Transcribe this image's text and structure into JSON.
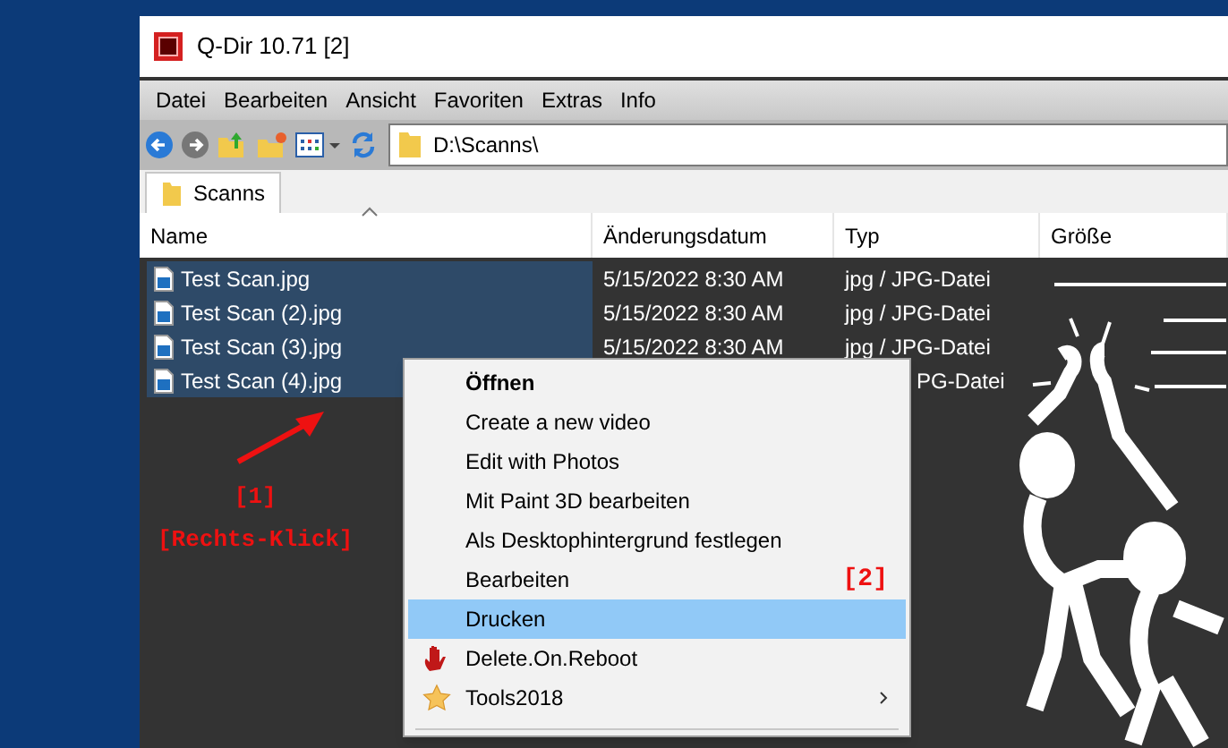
{
  "window": {
    "title": "Q-Dir 10.71 [2]"
  },
  "menu_bar": [
    "Datei",
    "Bearbeiten",
    "Ansicht",
    "Favoriten",
    "Extras",
    "Info"
  ],
  "address": {
    "value": "D:\\Scanns\\"
  },
  "tabs": [
    {
      "label": "Scanns",
      "selected": true
    }
  ],
  "table": {
    "columns": [
      "Name",
      "Änderungsdatum",
      "Typ",
      "Größe"
    ],
    "rows": [
      {
        "name": "Test Scan.jpg",
        "date": "5/15/2022 8:30 AM",
        "type": "jpg / JPG-Datei",
        "selected": true
      },
      {
        "name": "Test Scan (2).jpg",
        "date": "5/15/2022 8:30 AM",
        "type": "jpg / JPG-Datei",
        "selected": true
      },
      {
        "name": "Test Scan (3).jpg",
        "date": "5/15/2022 8:30 AM",
        "type": "jpg / JPG-Datei",
        "selected": true
      },
      {
        "name": "Test Scan (4).jpg",
        "type": "PG-Datei",
        "selected": true
      }
    ]
  },
  "context_menu": [
    {
      "label": "Öffnen",
      "kind": "default",
      "selected": false
    },
    {
      "label": "Create a new video",
      "kind": "plain",
      "selected": false
    },
    {
      "label": "Edit with Photos",
      "kind": "plain",
      "selected": false
    },
    {
      "label": "Mit Paint 3D bearbeiten",
      "kind": "plain",
      "selected": false
    },
    {
      "label": "Als Desktophintergrund festlegen",
      "kind": "plain",
      "selected": false
    },
    {
      "label": "Bearbeiten",
      "kind": "plain",
      "selected": false,
      "note": "[2]"
    },
    {
      "label": "Drucken",
      "kind": "plain",
      "selected": true
    },
    {
      "label": "Delete.On.Reboot",
      "kind": "hand",
      "selected": false
    },
    {
      "label": "Tools2018",
      "kind": "star",
      "selected": false,
      "submenu": true
    }
  ],
  "annotation": {
    "marker": "[1]",
    "text": "[Rechts-Klick]"
  }
}
